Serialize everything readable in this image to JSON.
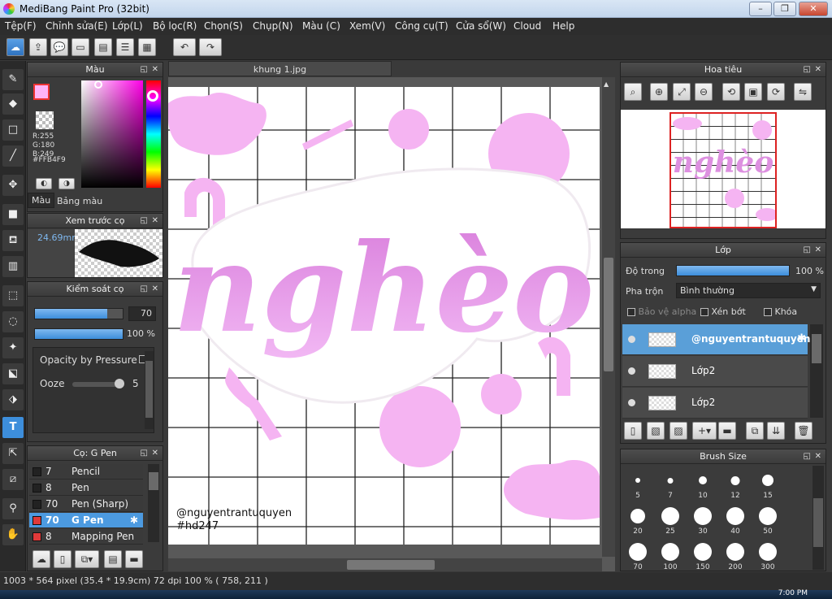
{
  "window": {
    "title": "MediBang Paint Pro (32bit)",
    "min": "–",
    "max": "❐",
    "close": "✕"
  },
  "menu": [
    "Tệp(F)",
    "Chỉnh sửa(E)",
    "Lớp(L)",
    "Bộ lọc(R)",
    "Chọn(S)",
    "Chụp(N)",
    "Màu (C)",
    "Xem(V)",
    "Công cụ(T)",
    "Cửa sổ(W)",
    "Cloud",
    "Help"
  ],
  "color_panel": {
    "title": "Màu",
    "rgb": [
      "R:255",
      "G:180",
      "B:249"
    ],
    "hex": "#FFB4F9",
    "tabs": [
      "Màu",
      "Bảng màu"
    ],
    "primary": "#FFB4F9"
  },
  "brush_preview": {
    "title": "Xem trước cọ",
    "size": "24.69mm"
  },
  "brush_control": {
    "title": "Kiểm soát cọ",
    "size_value": "70",
    "opacity_value": "100 %",
    "size_fraction": 0.82,
    "opacity_fraction": 1.0
  },
  "brush_options": {
    "opacity_by_pressure": "Opacity by Pressure",
    "ooze": "Ooze",
    "ooze_value": "5"
  },
  "brush_list": {
    "title": "Cọ: G Pen",
    "items": [
      {
        "num": "7",
        "name": "Pencil",
        "color": "#222222"
      },
      {
        "num": "8",
        "name": "Pen",
        "color": "#222222"
      },
      {
        "num": "70",
        "name": "Pen (Sharp)",
        "color": "#222222"
      },
      {
        "num": "70",
        "name": "G Pen",
        "color": "#e03a3a",
        "selected": true
      },
      {
        "num": "8",
        "name": "Mapping Pen",
        "color": "#e03a3a"
      }
    ]
  },
  "document": {
    "tab": "khung 1.jpg",
    "watermark1": "@nguyentrantuquyen",
    "watermark2": "#hd247",
    "main_word": "nghèo"
  },
  "navigator": {
    "title": "Hoa tiêu"
  },
  "layers": {
    "title": "Lớp",
    "opacity_label": "Độ trong",
    "opacity_value": "100 %",
    "blend_label": "Pha trộn",
    "blend_value": "Bình thường",
    "protect_alpha": "Bảo vệ alpha",
    "clipping": "Xén bớt",
    "lock": "Khóa",
    "items": [
      {
        "name": "@nguyentrantuquyen",
        "selected": true
      },
      {
        "name": "Lớp2"
      },
      {
        "name": "Lớp2"
      }
    ]
  },
  "brush_size": {
    "title": "Brush Size",
    "row1": [
      "5",
      "7",
      "10",
      "12",
      "15"
    ],
    "row2": [
      "20",
      "25",
      "30",
      "40",
      "50"
    ],
    "row3": [
      "70",
      "100",
      "150",
      "200",
      "300"
    ]
  },
  "status": {
    "text": "1003 * 564 pixel  (35.4 * 19.9cm)  72 dpi  100 %  ( 758, 211 )"
  },
  "taskbar": {
    "time": "7:00 PM"
  }
}
